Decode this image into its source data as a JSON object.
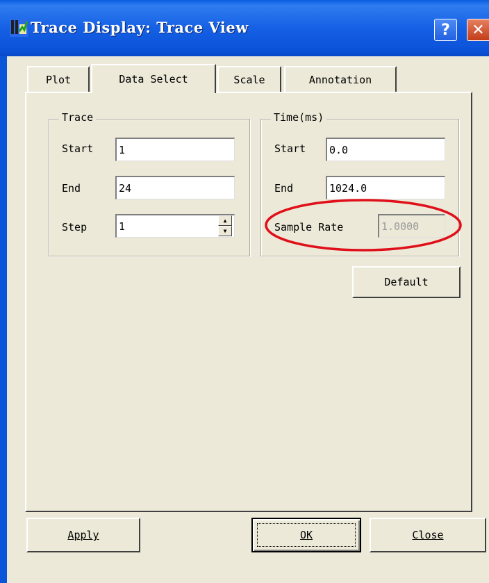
{
  "window": {
    "title": "Trace Display: Trace View"
  },
  "tabs": [
    {
      "label": "Plot",
      "active": false
    },
    {
      "label": "Data Select",
      "active": true
    },
    {
      "label": "Scale",
      "active": false
    },
    {
      "label": "Annotation",
      "active": false
    }
  ],
  "trace_group": {
    "title": "Trace",
    "start_label": "Start",
    "start_value": "1",
    "end_label": "End",
    "end_value": "24",
    "step_label": "Step",
    "step_value": "1"
  },
  "time_group": {
    "title": "Time(ms)",
    "start_label": "Start",
    "start_value": "0.0",
    "end_label": "End",
    "end_value": "1024.0",
    "sample_rate_label": "Sample Rate",
    "sample_rate_value": "1.0000"
  },
  "buttons": {
    "default_label": "Default",
    "apply_label": "Apply",
    "ok_label": "OK",
    "close_label": "Close"
  },
  "colors": {
    "title_bar": "#0a5ee0",
    "dialog_bg": "#ece9d8",
    "highlight_ellipse": "#e0101a"
  },
  "icons": [
    "trace-display-icon",
    "help-icon",
    "close-icon",
    "spin-up-icon",
    "spin-down-icon"
  ]
}
